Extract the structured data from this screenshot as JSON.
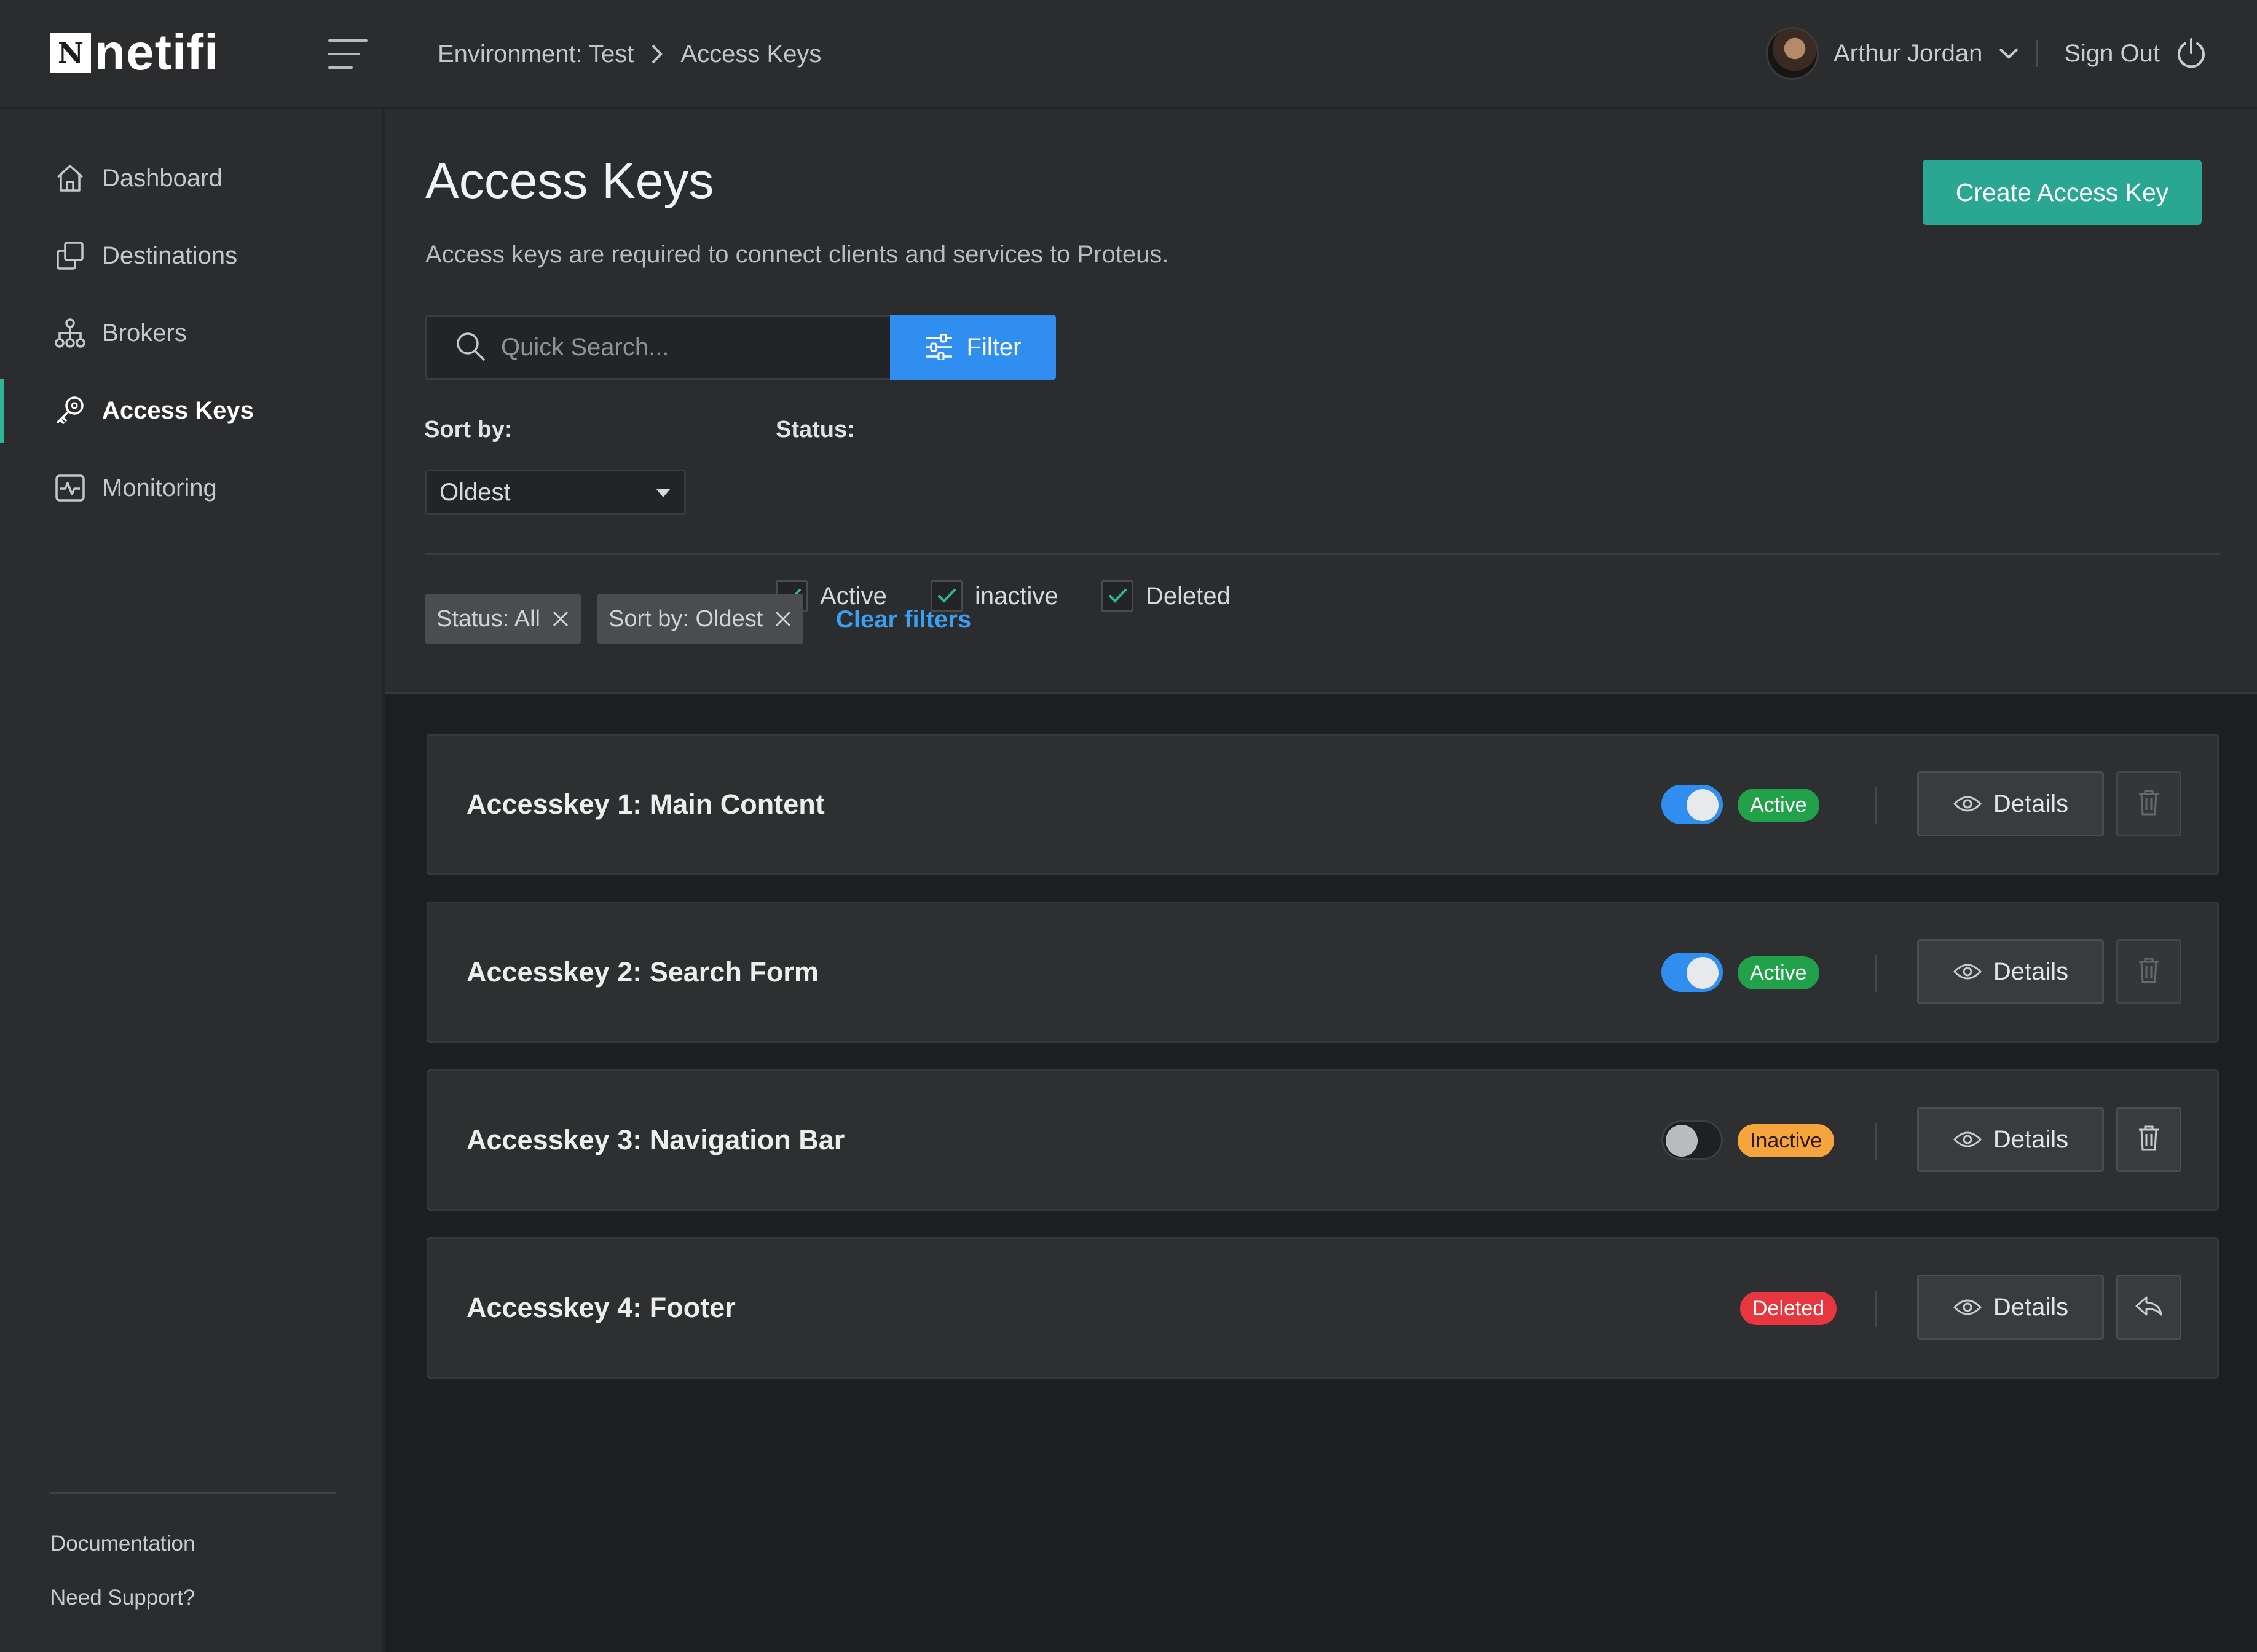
{
  "app": {
    "logo_letter": "N",
    "logo_text": "netifi"
  },
  "breadcrumb": {
    "environment": "Environment: Test",
    "current": "Access Keys"
  },
  "user": {
    "name": "Arthur Jordan",
    "sign_out": "Sign Out"
  },
  "sidebar": {
    "items": [
      {
        "label": "Dashboard",
        "icon": "home-icon",
        "active": false
      },
      {
        "label": "Destinations",
        "icon": "copy-icon",
        "active": false
      },
      {
        "label": "Brokers",
        "icon": "network-icon",
        "active": false
      },
      {
        "label": "Access Keys",
        "icon": "key-icon",
        "active": true
      },
      {
        "label": "Monitoring",
        "icon": "activity-icon",
        "active": false
      }
    ],
    "footer_links": [
      "Documentation",
      "Need Support?"
    ]
  },
  "page": {
    "title": "Access Keys",
    "description": "Access keys are required to connect clients and services to Proteus.",
    "create_button": "Create Access Key"
  },
  "search": {
    "placeholder": "Quick Search...",
    "value": "",
    "filter_button": "Filter"
  },
  "filters": {
    "sort_label": "Sort by:",
    "sort_value": "Oldest",
    "status_label": "Status:",
    "status_options": [
      {
        "label": "Active",
        "checked": true
      },
      {
        "label": "inactive",
        "checked": true
      },
      {
        "label": "Deleted",
        "checked": true
      }
    ],
    "chips": [
      "Status: All",
      "Sort by: Oldest"
    ],
    "clear_label": "Clear filters"
  },
  "keys": [
    {
      "name": "Accesskey 1: Main Content",
      "toggle": "on",
      "status": "Active",
      "details": "Details",
      "action": "trash-icon",
      "action_enabled": false
    },
    {
      "name": "Accesskey 2: Search Form",
      "toggle": "on",
      "status": "Active",
      "details": "Details",
      "action": "trash-icon",
      "action_enabled": false
    },
    {
      "name": "Accesskey 3: Navigation Bar",
      "toggle": "off",
      "status": "Inactive",
      "details": "Details",
      "action": "trash-icon",
      "action_enabled": true
    },
    {
      "name": "Accesskey 4: Footer",
      "toggle": "none",
      "status": "Deleted",
      "details": "Details",
      "action": "restore-icon",
      "action_enabled": true
    }
  ],
  "colors": {
    "accent_teal": "#2aa793",
    "accent_blue": "#2f8ef0",
    "status_active": "#20a14a",
    "status_inactive": "#f5a53c",
    "status_deleted": "#e8363e"
  }
}
